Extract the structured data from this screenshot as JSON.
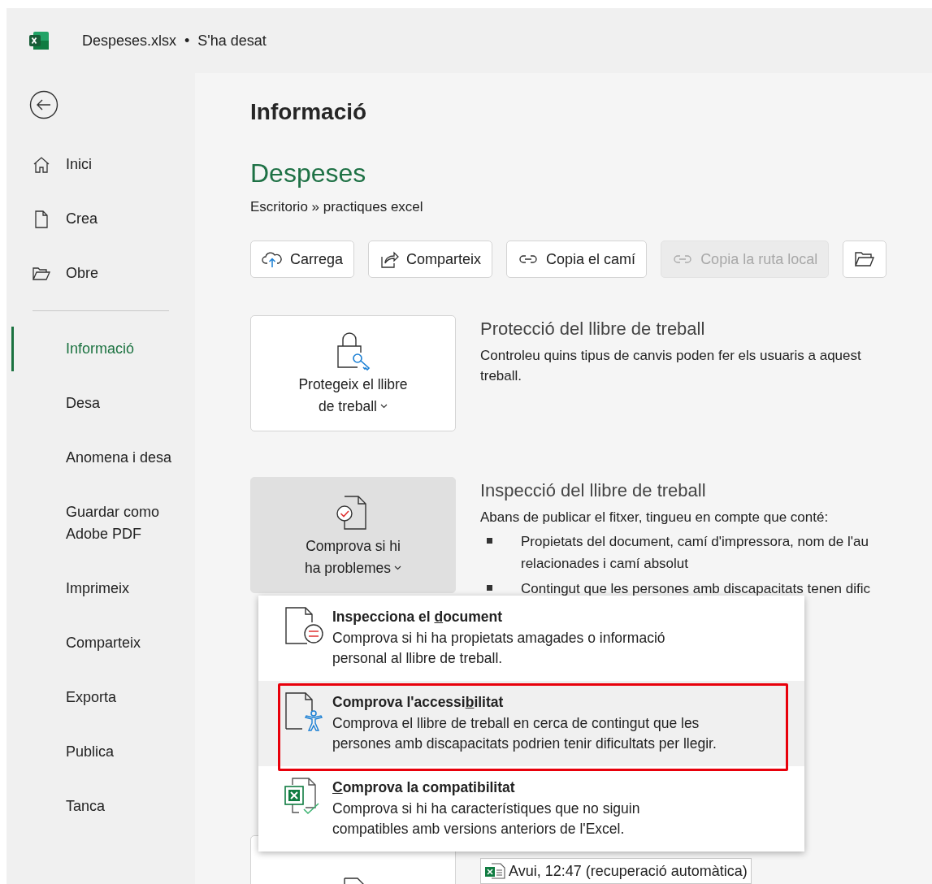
{
  "title_bar": {
    "file_name": "Despeses.xlsx",
    "separator": "•",
    "status": "S'ha desat"
  },
  "sidebar": {
    "nav": [
      {
        "label": "Inici",
        "kind": "home",
        "selected": false
      },
      {
        "label": "Crea",
        "kind": "new",
        "selected": false
      },
      {
        "label": "Obre",
        "kind": "open",
        "selected": false
      }
    ],
    "items": [
      {
        "label": "Informació",
        "selected": true
      },
      {
        "label": "Desa",
        "selected": false
      },
      {
        "label": "Anomena i desa",
        "selected": false
      },
      {
        "label": "Guardar como\nAdobe PDF",
        "selected": false
      },
      {
        "label": "Imprimeix",
        "selected": false
      },
      {
        "label": "Comparteix",
        "selected": false
      },
      {
        "label": "Exporta",
        "selected": false
      },
      {
        "label": "Publica",
        "selected": false
      },
      {
        "label": "Tanca",
        "selected": false
      }
    ]
  },
  "page": {
    "heading": "Informació",
    "document_name": "Despeses",
    "location": "Escritorio » practiques excel",
    "buttons": [
      {
        "label": "Carrega",
        "kind": "upload",
        "disabled": false
      },
      {
        "label": "Comparteix",
        "kind": "share",
        "disabled": false
      },
      {
        "label": "Copia el camí",
        "kind": "link",
        "disabled": false
      },
      {
        "label": "Copia la ruta local",
        "kind": "link",
        "disabled": true
      },
      {
        "kind": "folder",
        "disabled": false
      }
    ],
    "sections": [
      {
        "card": {
          "kind": "lock",
          "lines": [
            "Protegeix el llibre",
            "de treball"
          ],
          "pressed": false
        },
        "heading": "Protecció del llibre de treball",
        "description": [
          "Controleu quins tipus de canvis poden fer els usuaris a aquest",
          "treball."
        ]
      },
      {
        "card": {
          "kind": "check",
          "lines": [
            "Comprova si hi",
            "ha problemes"
          ],
          "pressed": true
        },
        "heading": "Inspecció del llibre de treball",
        "description": [
          "Abans de publicar el fitxer, tingueu en compte que conté:"
        ],
        "bullets": [
          [
            "Propietats del document, camí d'impressora, nom de l'au",
            "relacionades i camí absolut"
          ],
          [
            "Contingut que les persones amb discapacitats tenen dific"
          ]
        ]
      },
      {
        "card": {
          "kind": "versions",
          "pressed": false
        },
        "versions": [
          "Avui, 12:47 (recuperació automàtica)"
        ]
      }
    ]
  },
  "menu": {
    "items": [
      {
        "kind": "inspect",
        "title": {
          "before": "Inspecciona el ",
          "key": "d",
          "after": "ocument"
        },
        "description": [
          "Comprova si hi ha propietats amagades o informació",
          "personal al llibre de treball."
        ],
        "selected": false,
        "framed": false
      },
      {
        "kind": "accessibility",
        "title": {
          "before": "Comprova l'accessi",
          "key": "b",
          "after": "ilitat"
        },
        "description": [
          "Comprova el llibre de treball en cerca de contingut que les",
          "persones amb discapacitats podrien tenir dificultats per llegir."
        ],
        "selected": true,
        "framed": true
      },
      {
        "kind": "compatibility",
        "title": {
          "key": "C",
          "after": "omprova la compatibilitat"
        },
        "description": [
          "Comprova si hi ha característiques que no siguin",
          "compatibles amb versions anteriors de l'Excel."
        ],
        "selected": false,
        "framed": false
      }
    ]
  }
}
